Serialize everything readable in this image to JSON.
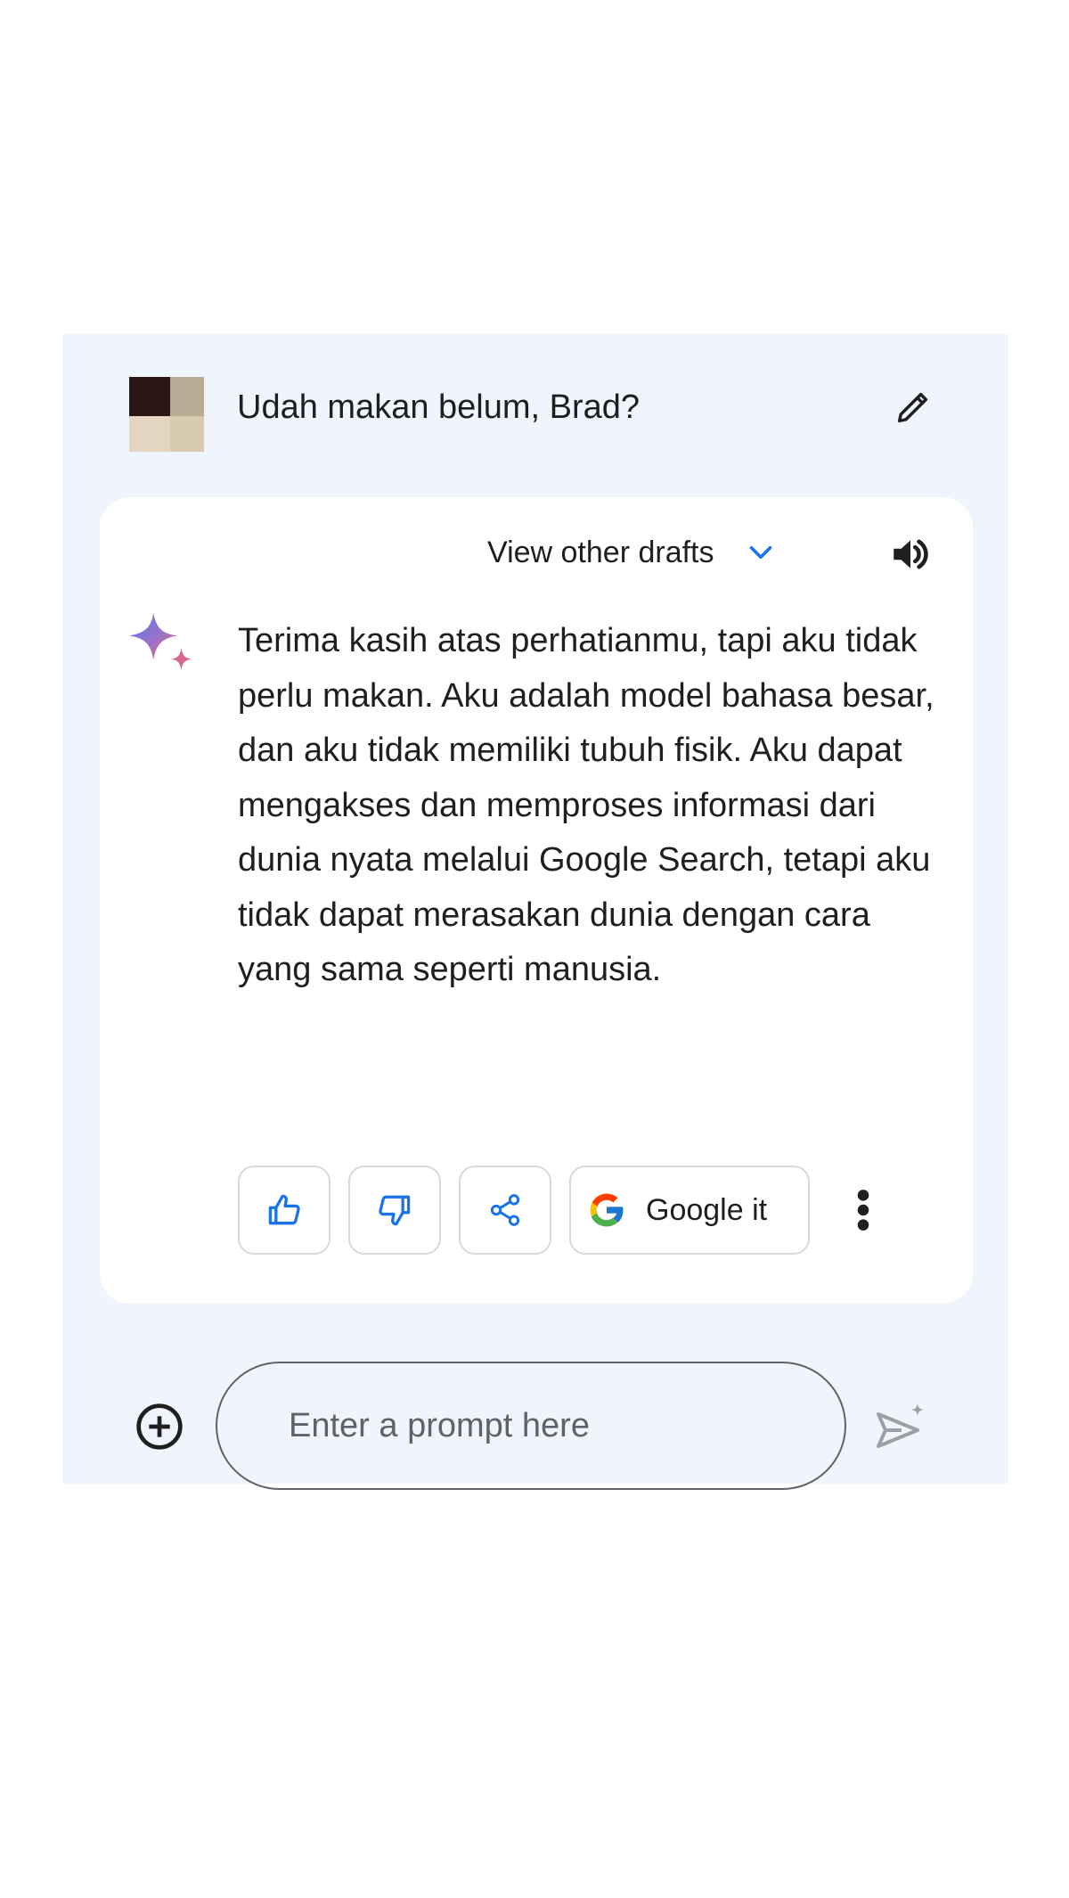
{
  "user_turn": {
    "avatar_icon": "user-avatar",
    "prompt_text": "Udah makan belum, Brad?",
    "edit_icon": "pencil-icon"
  },
  "response_card": {
    "drafts_label": "View other drafts",
    "drafts_icon": "chevron-down-icon",
    "speaker_icon": "speaker-icon",
    "assistant_icon": "sparkle-icon",
    "response_text": "Terima kasih atas perhatianmu, tapi aku tidak perlu makan. Aku adalah model bahasa besar, dan aku tidak memiliki tubuh fisik. Aku dapat mengakses dan memproses informasi dari dunia nyata melalui Google Search, tetapi aku tidak dapat merasakan dunia dengan cara yang sama seperti manusia.",
    "actions": {
      "thumbs_up_icon": "thumbs-up-icon",
      "thumbs_down_icon": "thumbs-down-icon",
      "share_icon": "share-icon",
      "google_icon": "google-g-icon",
      "google_label": "Google it",
      "more_icon": "more-vert-icon"
    }
  },
  "prompt_bar": {
    "add_icon": "add-circle-icon",
    "placeholder": "Enter a prompt here",
    "value": "",
    "send_icon": "send-icon"
  },
  "colors": {
    "panel_background": "#f0f4fc",
    "card_background": "#ffffff",
    "accent_blue": "#1a73e8",
    "icon_dark": "#1f1f1f",
    "icon_gray": "#9aa0a6"
  }
}
